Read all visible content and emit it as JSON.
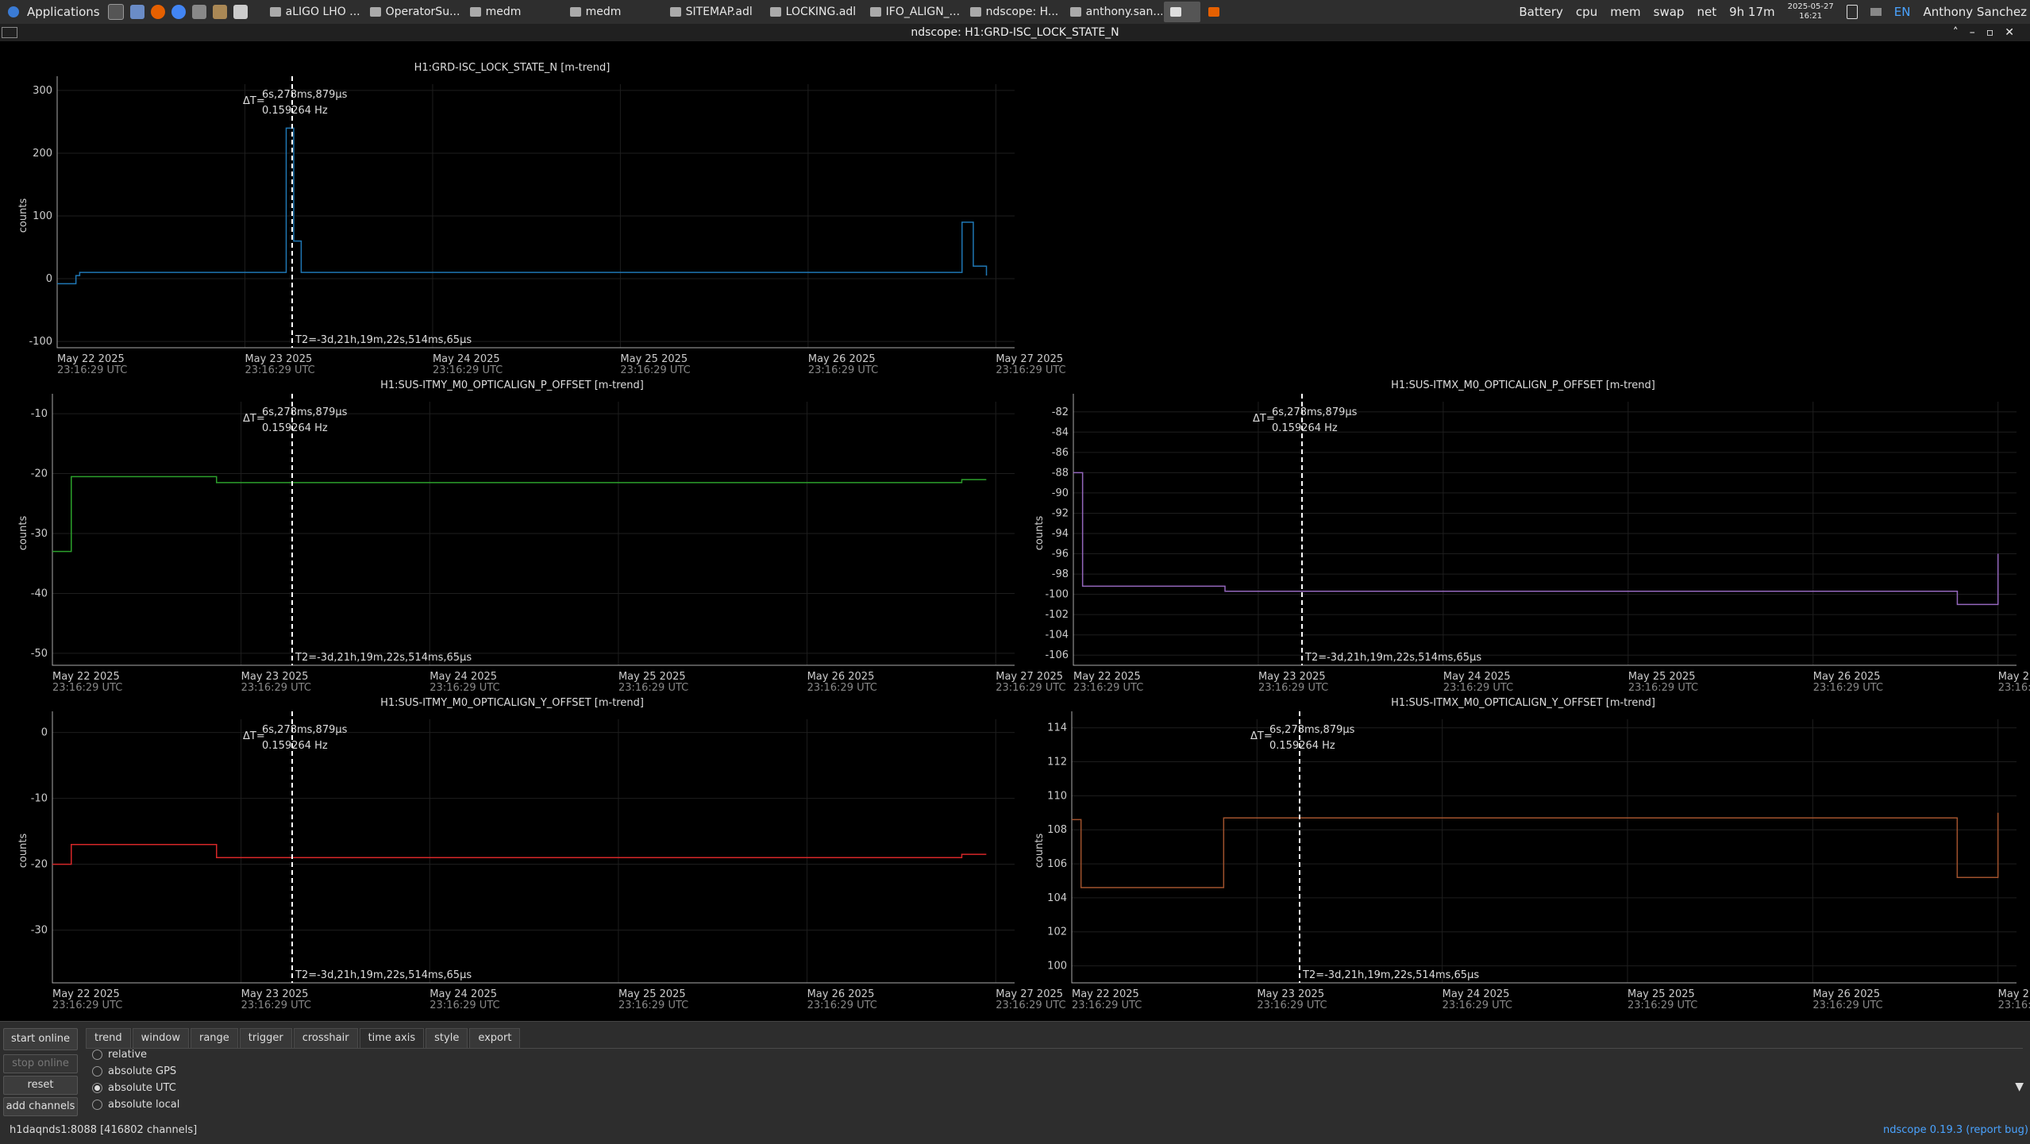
{
  "taskbar": {
    "applications_label": "Applications",
    "tasks": [
      {
        "label": "aLIGO LHO ...",
        "active": false
      },
      {
        "label": "OperatorSu...",
        "active": false
      },
      {
        "label": "medm",
        "active": false
      },
      {
        "label": "medm",
        "active": false
      },
      {
        "label": "SITEMAP.adl",
        "active": false
      },
      {
        "label": "LOCKING.adl",
        "active": false
      },
      {
        "label": "IFO_ALIGN_...",
        "active": false
      },
      {
        "label": "ndscope: H...",
        "active": false
      },
      {
        "label": "anthony.san...",
        "active": false
      }
    ],
    "indicators": [
      "Battery",
      "cpu",
      "mem",
      "swap",
      "net"
    ],
    "uptime": "9h 17m",
    "date": "2025-05-27",
    "time": "16:21",
    "lang": "EN",
    "user": "Anthony Sanchez"
  },
  "window_title": "ndscope: H1:GRD-ISC_LOCK_STATE_N",
  "cursor": {
    "delta_t_label": "ΔT=",
    "delta_t": "6s,278ms,879μs",
    "freq": "0.159264 Hz",
    "t2": "T2=-3d,21h,19m,22s,514ms,65μs"
  },
  "x_ticks": [
    {
      "date": "May 22 2025",
      "time": "23:16:29 UTC"
    },
    {
      "date": "May 23 2025",
      "time": "23:16:29 UTC"
    },
    {
      "date": "May 24 2025",
      "time": "23:16:29 UTC"
    },
    {
      "date": "May 25 2025",
      "time": "23:16:29 UTC"
    },
    {
      "date": "May 26 2025",
      "time": "23:16:29 UTC"
    },
    {
      "date": "May 27 2025",
      "time": "23:16:29 UTC"
    }
  ],
  "chart_data": [
    {
      "type": "line",
      "title": "H1:GRD-ISC_LOCK_STATE_N [m-trend]",
      "ylabel": "counts",
      "ylim": [
        -110,
        310
      ],
      "yticks": [
        300,
        200,
        100,
        0,
        -100
      ],
      "color": "#1f77b4",
      "series": [
        {
          "x": [
            0,
            0.08,
            0.1,
            0.12,
            1.2,
            1.22,
            1.26,
            1.3,
            4.8,
            4.82,
            4.88,
            4.95
          ],
          "values": [
            -8,
            -8,
            5,
            10,
            10,
            240,
            60,
            10,
            10,
            90,
            20,
            5
          ]
        }
      ]
    },
    {
      "type": "line",
      "title": "H1:SUS-ITMY_M0_OPTICALIGN_P_OFFSET [m-trend]",
      "ylabel": "counts",
      "ylim": [
        -52,
        -8
      ],
      "yticks": [
        -10,
        -20,
        -30,
        -40,
        -50
      ],
      "color": "#2ca02c",
      "series": [
        {
          "x": [
            0,
            0.08,
            0.1,
            0.85,
            0.87,
            4.8,
            4.82,
            4.95
          ],
          "values": [
            -33,
            -33,
            -20.5,
            -20.5,
            -21.5,
            -21.5,
            -21,
            -21
          ]
        }
      ]
    },
    {
      "type": "line",
      "title": "H1:SUS-ITMX_M0_OPTICALIGN_P_OFFSET [m-trend]",
      "ylabel": "counts",
      "ylim": [
        -107,
        -81
      ],
      "yticks": [
        -82,
        -84,
        -86,
        -88,
        -90,
        -92,
        -94,
        -96,
        -98,
        -100,
        -102,
        -104,
        -106
      ],
      "color": "#9467bd",
      "series": [
        {
          "x": [
            0,
            0.03,
            0.05,
            0.8,
            0.82,
            4.75,
            4.78,
            4.98,
            5.0
          ],
          "values": [
            -88,
            -88,
            -99.2,
            -99.2,
            -99.7,
            -99.7,
            -101,
            -101,
            -96
          ]
        }
      ]
    },
    {
      "type": "line",
      "title": "H1:SUS-ITMY_M0_OPTICALIGN_Y_OFFSET [m-trend]",
      "ylabel": "counts",
      "ylim": [
        -38,
        2
      ],
      "yticks": [
        0,
        -10,
        -20,
        -30
      ],
      "color": "#d62728",
      "series": [
        {
          "x": [
            0,
            0.08,
            0.1,
            0.85,
            0.87,
            4.8,
            4.82,
            4.95
          ],
          "values": [
            -20,
            -20,
            -17,
            -17,
            -19,
            -19,
            -18.5,
            -18.5
          ]
        }
      ]
    },
    {
      "type": "line",
      "title": "H1:SUS-ITMX_M0_OPTICALIGN_Y_OFFSET [m-trend]",
      "ylabel": "counts",
      "ylim": [
        99,
        114.5
      ],
      "yticks": [
        114,
        112,
        110,
        108,
        106,
        104,
        102,
        100
      ],
      "color": "#a0522d",
      "series": [
        {
          "x": [
            0,
            0.03,
            0.05,
            0.8,
            0.82,
            4.75,
            4.78,
            4.98,
            5.0
          ],
          "values": [
            108.6,
            108.6,
            104.6,
            104.6,
            108.7,
            108.7,
            105.2,
            105.2,
            109
          ]
        }
      ]
    }
  ],
  "controls": {
    "start_online": "start online",
    "stop_online": "stop online",
    "reset": "reset",
    "add_channels": "add channels",
    "tabs": [
      "trend",
      "window",
      "range",
      "trigger",
      "crosshair",
      "time axis",
      "style",
      "export"
    ],
    "active_tab": "time axis",
    "radio_options": [
      {
        "label": "relative",
        "checked": false
      },
      {
        "label": "absolute GPS",
        "checked": false
      },
      {
        "label": "absolute UTC",
        "checked": true
      },
      {
        "label": "absolute local",
        "checked": false
      }
    ]
  },
  "status": "h1daqnds1:8088  [416802 channels]",
  "version": {
    "name": "ndscope",
    "number": "0.19.3",
    "report": "(report bug)"
  }
}
